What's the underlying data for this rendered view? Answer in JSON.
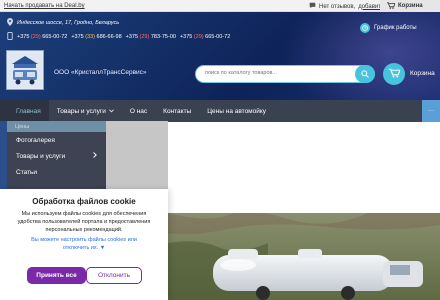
{
  "topbar": {
    "start_link": "Начать продавать на Deal.by",
    "reviews_text": "Нет отзывов,",
    "reviews_link": "добавить",
    "cart_label": "Корзина"
  },
  "header": {
    "address": "Индесское шоссе, 17, Гродно, Беларусь",
    "phones": [
      {
        "prefix": "+375",
        "code": "(29)",
        "number": "665-00-72"
      },
      {
        "prefix": "+375",
        "code": "(33)",
        "number": "686-66-98"
      },
      {
        "prefix": "+375",
        "code": "(29)",
        "number": "783-75-00"
      },
      {
        "prefix": "+375",
        "code": "(29)",
        "number": "665-00-72"
      }
    ],
    "schedule_link": "График работы",
    "company_name": "ООО «КристаллТрансСервис»",
    "search_placeholder": "поиск по каталогу товаров...",
    "cart_label": "Корзина"
  },
  "nav": {
    "items": [
      "Главная",
      "Товары и услуги",
      "О нас",
      "Контакты",
      "Цены на автомойку"
    ],
    "more_label": "···"
  },
  "dropdown": {
    "selected": "Цены",
    "options": [
      "Фотогалерея",
      "Товары и услуги",
      "Статьи"
    ]
  },
  "cookie": {
    "title": "Обработка файлов cookie",
    "text": "Мы используем файлы cookies для обеспечения удобства пользователей портала и предоставления персональных рекомендаций.",
    "link": "Вы можете настроить файлы cookies или отключить их. ▼",
    "accept": "Принять все",
    "decline": "Отклонить"
  },
  "colors": {
    "accent": "#46c4dd",
    "primary_button": "#7a2aa8",
    "nav_bg": "#3a4150"
  },
  "icons": {
    "reviews": "speech-bubble-icon",
    "cart": "cart-icon",
    "location": "map-pin-icon",
    "phone": "phone-icon",
    "schedule": "clock-icon",
    "search": "search-icon"
  }
}
